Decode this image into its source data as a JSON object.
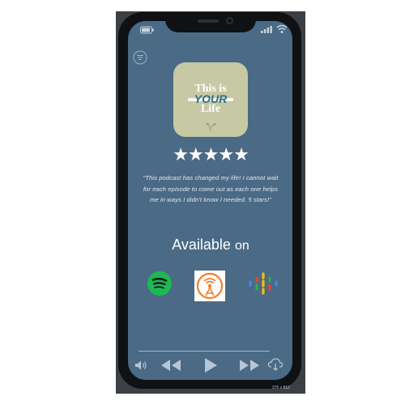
{
  "podcast": {
    "cover_line1": "This is",
    "cover_line2": "YOUR",
    "cover_line3": "Life",
    "rating_stars": 5,
    "stars_text": "★★★★★",
    "review": "\"This podcast has changed my life! I cannot wait for each episode to come out as each one helps me in ways I didn't know I needed. 5 stars!\""
  },
  "availability": {
    "title": "Available",
    "title_suffix": "on",
    "platforms": [
      "spotify-icon",
      "overcast-icon",
      "google-podcasts-icon"
    ]
  },
  "footer": {
    "size_label": "375 x 812"
  },
  "colors": {
    "screen": "#4a6a86",
    "phone": "#0f1114",
    "spotify": "#1db954",
    "overcast": "#f47d2a"
  }
}
